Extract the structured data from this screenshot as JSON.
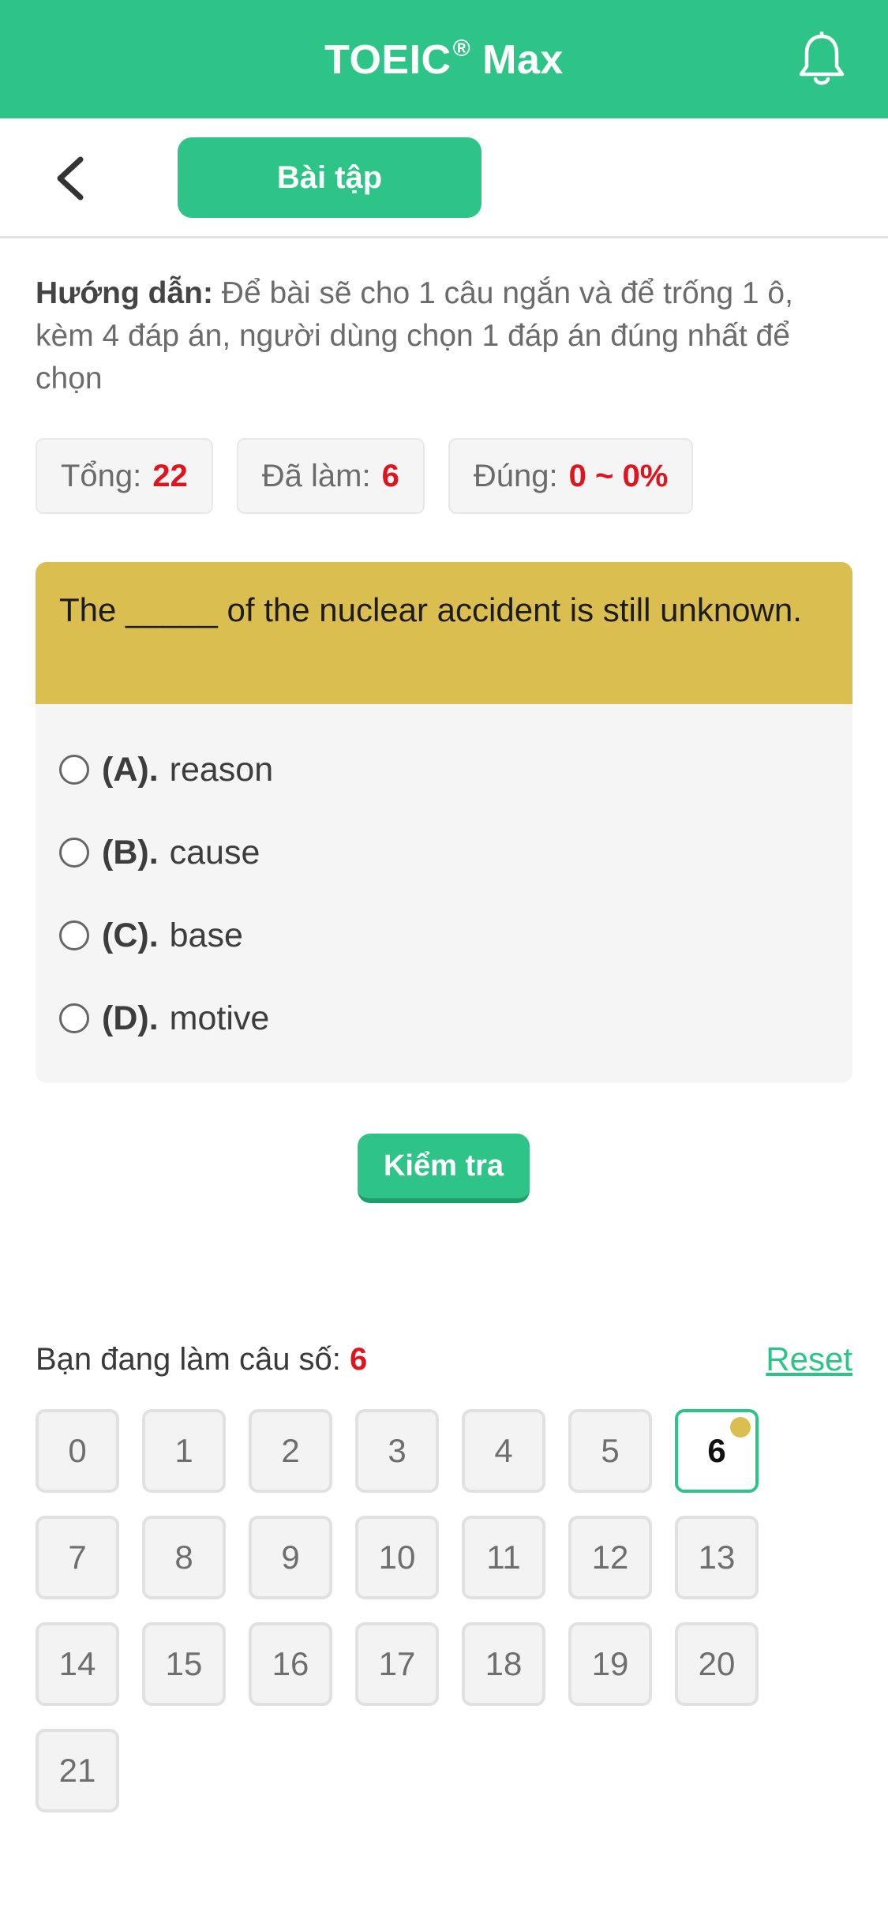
{
  "header": {
    "title": "TOEIC",
    "title_mark": "®",
    "title_suffix": " Max",
    "icon": "bell-icon"
  },
  "subheader": {
    "back_icon": "chevron-left-icon",
    "tab_label": "Bài tập"
  },
  "instructions": {
    "label": "Hướng dẫn:",
    "text": " Để bài sẽ cho 1 câu ngắn và để trống 1 ô, kèm 4 đáp án, người dùng chọn 1 đáp án đúng nhất để chọn"
  },
  "stats": {
    "total_label": "Tổng:",
    "total_value": "22",
    "done_label": "Đã làm:",
    "done_value": "6",
    "correct_label": "Đúng:",
    "correct_value": "0 ~ 0%"
  },
  "question": {
    "text": "The _____ of the nuclear accident is still unknown.",
    "options": [
      {
        "letter": "(A).",
        "text": "reason"
      },
      {
        "letter": "(B).",
        "text": "cause"
      },
      {
        "letter": "(C).",
        "text": "base"
      },
      {
        "letter": "(D).",
        "text": "motive"
      }
    ]
  },
  "check_button": "Kiểm tra",
  "progress": {
    "label": "Bạn đang làm câu số: ",
    "current": "6",
    "reset": "Reset"
  },
  "numbers": [
    "0",
    "1",
    "2",
    "3",
    "4",
    "5",
    "6",
    "7",
    "8",
    "9",
    "10",
    "11",
    "12",
    "13",
    "14",
    "15",
    "16",
    "17",
    "18",
    "19",
    "20",
    "21"
  ],
  "active_number": "6",
  "colors": {
    "accent": "#2ec488",
    "question_bg": "#dbbe50",
    "highlight": "#e0141e"
  }
}
